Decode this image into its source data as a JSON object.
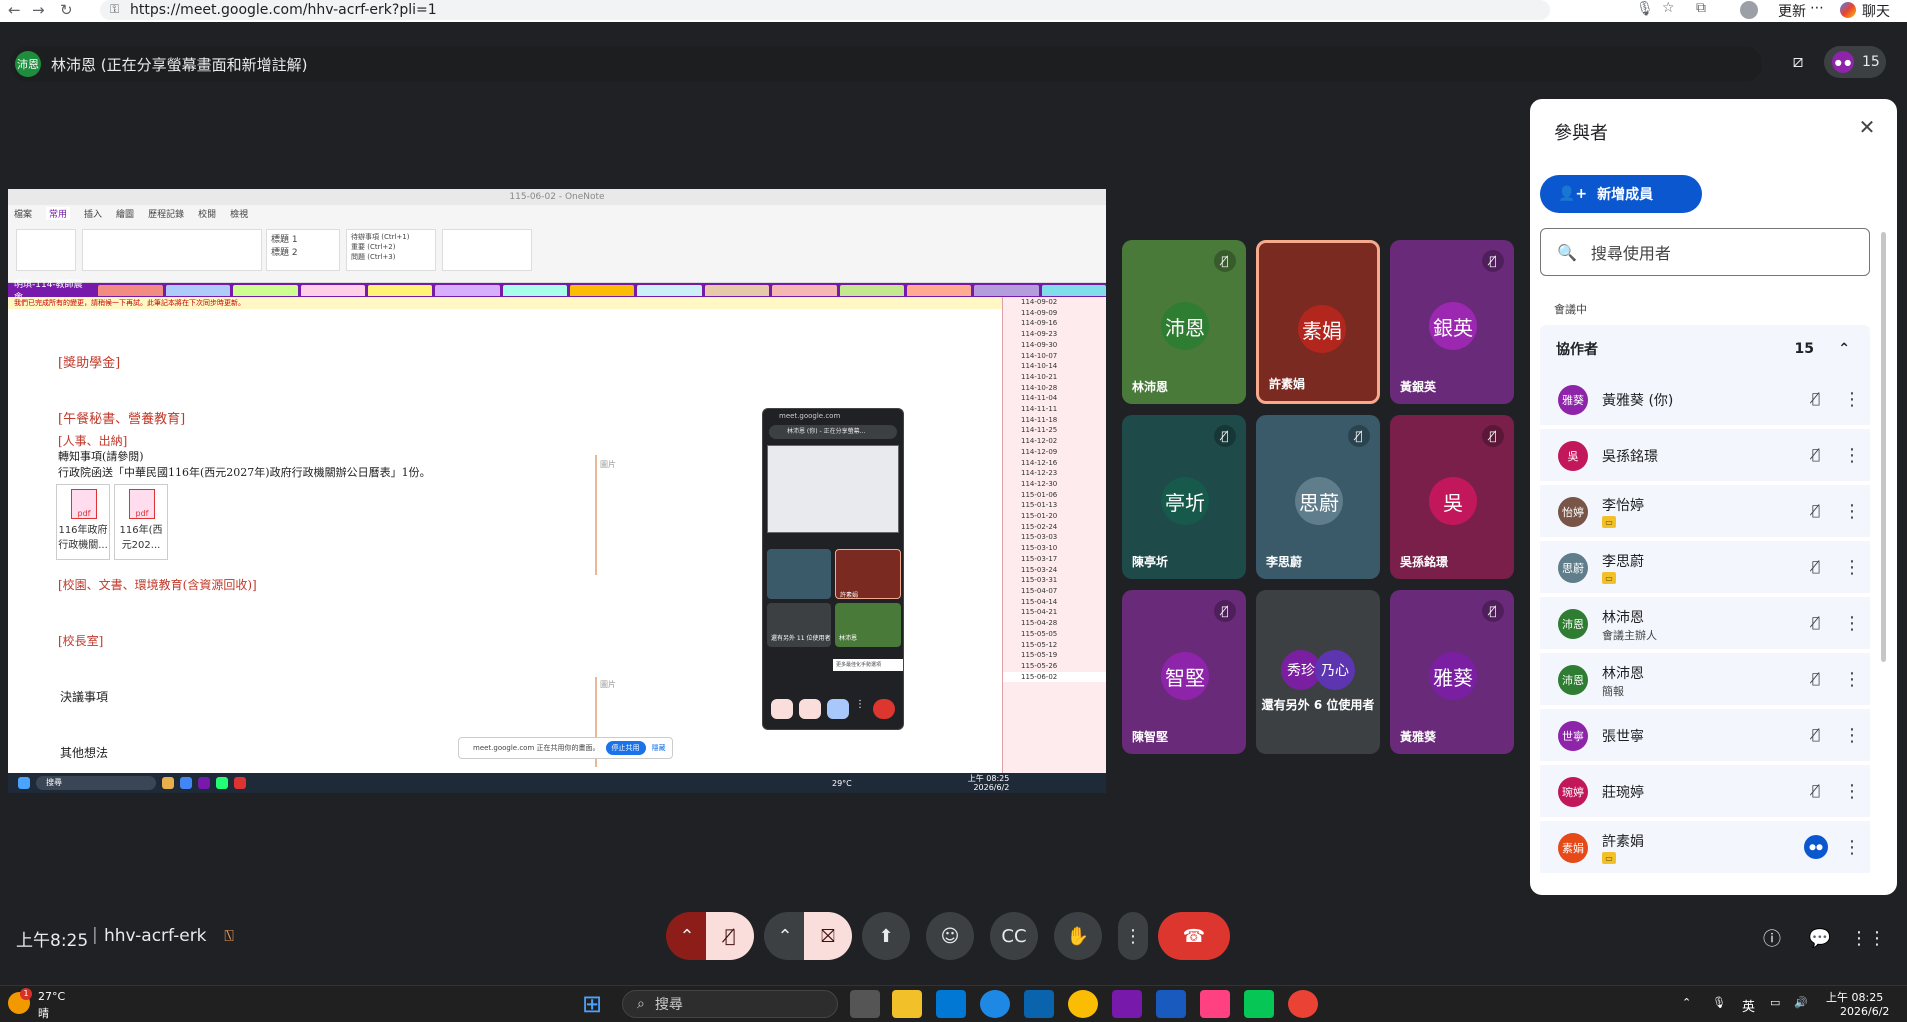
{
  "browser": {
    "url": "https://meet.google.com/hhv-acrf-erk?pli=1",
    "update_label": "更新",
    "chat_label": "聊天"
  },
  "presenter_bar": {
    "avatar_text": "沛恩",
    "title": "林沛恩 (正在分享螢幕畫面和新增註解)",
    "participant_count": "15"
  },
  "shared_screen": {
    "window_title": "115-06-02 - OneNote",
    "ribbon_tabs": [
      "檔案",
      "常用",
      "插入",
      "繪圖",
      "歷程記錄",
      "校閱",
      "檢視"
    ],
    "notebook": "明琪-114-教師晨會",
    "style_items": [
      "標題 1",
      "標題 2"
    ],
    "tag_items": [
      "待辦事項 (Ctrl+1)",
      "重要 (Ctrl+2)",
      "問題 (Ctrl+3)"
    ],
    "section_colors": [
      "#f28b82",
      "#aecbfa",
      "#ccff90",
      "#fdcfe8",
      "#fff475",
      "#d7aefb",
      "#a7ffeb",
      "#fbbc04",
      "#cbf0f8",
      "#e6c9a8",
      "#f5b7b1",
      "#c3e88d",
      "#ffab91",
      "#b39ddb",
      "#80deea"
    ],
    "warning": "我們已完成所有的變更，請稍候一下再試。此筆記本將在下次同步時更新。",
    "headings": [
      "[獎助學金]",
      "[午餐秘書、營養教育]",
      "[人事、出納]",
      "[校園、文書、環境教育(含資源回收)]",
      "[校長室]"
    ],
    "body_lines": [
      "轉知事項(請參閱)",
      "行政院函送「中華民國116年(西元2027年)政府行政機關辦公日曆表」1份。"
    ],
    "attachments": [
      "116年政府行政機關...",
      "116年(西元202..."
    ],
    "side_note": "圖片",
    "decision_label": "決議事項",
    "other_label": "其他想法",
    "share_notice": "meet.google.com 正在共用你的畫面。",
    "stop_share": "停止共用",
    "hide": "隱藏",
    "dates": [
      "114-09-02",
      "114-09-09",
      "114-09-16",
      "114-09-23",
      "114-09-30",
      "114-10-07",
      "114-10-14",
      "114-10-21",
      "114-10-28",
      "114-11-04",
      "114-11-11",
      "114-11-18",
      "114-11-25",
      "114-12-02",
      "114-12-09",
      "114-12-16",
      "114-12-23",
      "114-12-30",
      "115-01-06",
      "115-01-13",
      "115-01-20",
      "115-02-24",
      "115-03-03",
      "115-03-10",
      "115-03-17",
      "115-03-24",
      "115-03-31",
      "115-04-07",
      "115-04-14",
      "115-04-21",
      "115-04-28",
      "115-05-05",
      "115-05-12",
      "115-05-19",
      "115-05-26",
      "115-06-02"
    ],
    "taskbar_search": "搜尋",
    "weather": "29°C",
    "clock_time": "上午 08:25",
    "clock_date": "2026/6/2",
    "mini_url": "meet.google.com",
    "mini_title": "林沛恩 (你) - 正在分享螢幕...",
    "mini_more": "還有另外 11 位使用者",
    "mini_name1": "許素娟",
    "mini_name2": "林沛恩",
    "mini_tooltip": "更多最佳化手勢選項"
  },
  "tiles": [
    {
      "initial": "沛恩",
      "name": "林沛恩",
      "bg": "#4a7a3a",
      "av": "#2e7d32"
    },
    {
      "initial": "素娟",
      "name": "許素娟",
      "bg": "#7a2a20",
      "av": "#b3261e"
    },
    {
      "initial": "銀英",
      "name": "黃銀英",
      "bg": "#6a2a7a",
      "av": "#9c27b0"
    },
    {
      "initial": "亭圻",
      "name": "陳亭圻",
      "bg": "#1f4a4a",
      "av": "#17594a"
    },
    {
      "initial": "思蔚",
      "name": "李思蔚",
      "bg": "#3a5a6a",
      "av": "#607d8b"
    },
    {
      "initial": "吳",
      "name": "吳孫銘璟",
      "bg": "#7a1f4a",
      "av": "#c2185b"
    },
    {
      "initial": "智堅",
      "name": "陳智堅",
      "bg": "#6a2a7a",
      "av": "#8e24aa"
    },
    {
      "initial_a": "秀珍",
      "initial_b": "乃心",
      "more": "還有另外 6 位使用者",
      "bg": "#3c4043"
    },
    {
      "initial": "雅葵",
      "name": "黃雅葵",
      "bg": "#6a2a7a",
      "av": "#7b1fa2"
    }
  ],
  "panel": {
    "title": "參與者",
    "add_label": "新增成員",
    "search_placeholder": "搜尋使用者",
    "in_meeting": "會議中",
    "group_label": "協作者",
    "group_count": "15",
    "people": [
      {
        "initial": "雅葵",
        "name": "黃雅葵 (你)",
        "sub": "",
        "color": "#8e24aa"
      },
      {
        "initial": "吳",
        "name": "吳孫銘璟",
        "sub": "",
        "color": "#c2185b"
      },
      {
        "initial": "怡婷",
        "name": "李怡婷",
        "sub": "",
        "color": "#795548"
      },
      {
        "initial": "思蔚",
        "name": "李思蔚",
        "sub": "",
        "color": "#607d8b"
      },
      {
        "initial": "沛恩",
        "name": "林沛恩",
        "sub": "會議主辦人",
        "color": "#2e7d32"
      },
      {
        "initial": "沛恩",
        "name": "林沛恩",
        "sub": "簡報",
        "color": "#2e7d32"
      },
      {
        "initial": "世寧",
        "name": "張世寧",
        "sub": "",
        "color": "#8e24aa"
      },
      {
        "initial": "琬婷",
        "name": "莊琬婷",
        "sub": "",
        "color": "#c2185b"
      },
      {
        "initial": "素娟",
        "name": "許素娟",
        "sub": "",
        "color": "#e64a19"
      }
    ]
  },
  "footer": {
    "time": "上午8:25",
    "code": "hhv-acrf-erk"
  },
  "taskbar": {
    "weather_temp": "27°C",
    "weather_desc": "晴",
    "notify_count": "1",
    "search": "搜尋",
    "lang": "英",
    "time": "上午 08:25",
    "date": "2026/6/2"
  }
}
